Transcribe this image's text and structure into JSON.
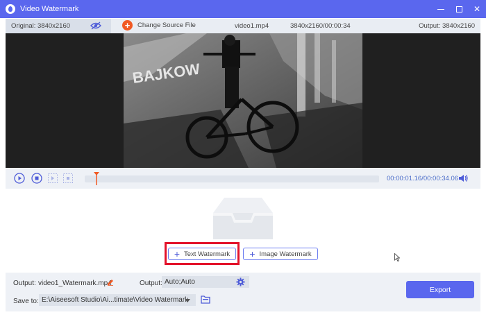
{
  "window": {
    "title": "Video Watermark"
  },
  "infobar": {
    "original": "Original: 3840x2160",
    "change_source": "Change Source File",
    "filename": "video1.mp4",
    "file_info": "3840x2160/00:00:34",
    "output": "Output: 3840x2160"
  },
  "player": {
    "timecode": "00:00:01.16/00:00:34.06",
    "progress": 0.04
  },
  "watermark": {
    "text_button": "Text Watermark",
    "image_button": "Image Watermark"
  },
  "bottom": {
    "output_label": "Output:",
    "output_filename": "video1_Watermark.mp4",
    "format_label": "Output:",
    "format_value": "Auto;Auto",
    "save_label": "Save to:",
    "save_path": "E:\\Aiseesoft Studio\\Ai...timate\\Video Watermark",
    "export_button": "Export"
  },
  "colors": {
    "accent": "#5a67ee",
    "highlight": "#e3122a",
    "source_button": "#f15a24",
    "timecode": "#4a6cc8"
  },
  "icons": [
    "app-logo-icon",
    "minimize-icon",
    "maximize-icon",
    "close-icon",
    "eye-slash-icon",
    "add-icon",
    "play-icon",
    "stop-icon",
    "trim-start-icon",
    "trim-end-icon",
    "playhead-icon",
    "volume-icon",
    "empty-tray-icon",
    "edit-pencil-icon",
    "gear-icon",
    "folder-icon",
    "cursor-icon"
  ]
}
